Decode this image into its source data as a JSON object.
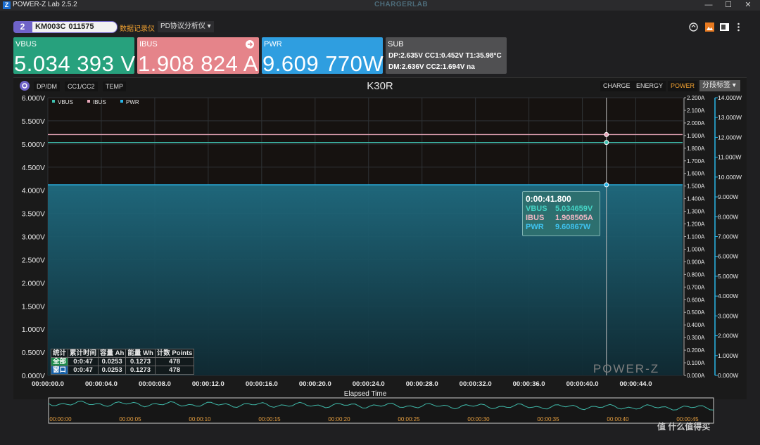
{
  "app": {
    "title": "POWER-Z Lab 2.5.2",
    "brand": "CHARGERLAB",
    "logo": "Z"
  },
  "window_controls": {
    "minimize": "—",
    "maximize": "☐",
    "close": "✕"
  },
  "device": {
    "index": "2",
    "model": "KM003C",
    "serial": "011575"
  },
  "modes": {
    "recorder": "数据记录仪",
    "pd_analyzer": "PD协议分析仪 ▾"
  },
  "cards": {
    "vbus": {
      "label": "VBUS",
      "value": "5.034 393 V",
      "color": "#27a17d"
    },
    "ibus": {
      "label": "IBUS",
      "value": "1.908 824 A",
      "color": "#e5848a"
    },
    "pwr": {
      "label": "PWR",
      "value": "9.609 770W",
      "color": "#2f9ee0"
    },
    "sub": {
      "label": "SUB",
      "row1": "DP:2.635V   CC1:0.452V  T1:35.98°C",
      "row2": "DM:2.636V   CC2:1.694V  na"
    }
  },
  "chart_toolbar": {
    "chips": [
      "DP/DM",
      "CC1/CC2",
      "TEMP"
    ],
    "tabs": [
      "CHARGE",
      "ENERGY",
      "POWER"
    ],
    "active_tab": "POWER",
    "select": "分段标签 ▾"
  },
  "chart_data": {
    "type": "line",
    "title": "K30R",
    "xlabel": "Elapsed Time",
    "x_ticks": [
      "00:00:00.0",
      "00:00:04.0",
      "00:00:08.0",
      "00:00:12.0",
      "00:00:16.0",
      "00:00:20.0",
      "00:00:24.0",
      "00:00:28.0",
      "00:00:32.0",
      "00:00:36.0",
      "00:00:40.0",
      "00:00:44.0"
    ],
    "xlim": [
      0,
      47.5
    ],
    "y_left": {
      "unit": "V",
      "range": [
        0,
        6
      ],
      "ticks": [
        "6.000V",
        "5.500V",
        "5.000V",
        "4.500V",
        "4.000V",
        "3.500V",
        "3.000V",
        "2.500V",
        "2.000V",
        "1.500V",
        "1.000V",
        "0.500V",
        "0.000V"
      ]
    },
    "y_mid": {
      "unit": "A",
      "range": [
        0,
        2.2
      ],
      "ticks": [
        "2.200A",
        "2.100A",
        "2.000A",
        "1.900A",
        "1.800A",
        "1.700A",
        "1.600A",
        "1.500A",
        "1.400A",
        "1.300A",
        "1.200A",
        "1.100A",
        "1.000A",
        "0.900A",
        "0.800A",
        "0.700A",
        "0.600A",
        "0.500A",
        "0.400A",
        "0.300A",
        "0.200A",
        "0.100A",
        "0.000A"
      ]
    },
    "y_right": {
      "unit": "W",
      "range": [
        0,
        14
      ],
      "ticks": [
        "14.000W",
        "13.000W",
        "12.000W",
        "11.000W",
        "10.000W",
        "9.000W",
        "8.000W",
        "7.000W",
        "6.000W",
        "5.000W",
        "4.000W",
        "3.000W",
        "2.000W",
        "1.000W",
        "0.000W"
      ]
    },
    "legend": [
      "VBUS",
      "IBUS",
      "PWR"
    ],
    "legend_placement": "top-left",
    "series": [
      {
        "name": "VBUS",
        "color": "#3fc1b0",
        "axis": "left",
        "x": [
          0,
          47.5
        ],
        "y": [
          5.034,
          5.034
        ]
      },
      {
        "name": "IBUS",
        "color": "#e8a6b8",
        "axis": "mid",
        "x": [
          0,
          47.5
        ],
        "y": [
          1.908,
          1.908
        ]
      },
      {
        "name": "PWR",
        "color": "#29b6e8",
        "axis": "right",
        "x": [
          0,
          47.5
        ],
        "y": [
          9.61,
          9.61
        ],
        "fill": true
      }
    ],
    "cursor_x": 41.8,
    "grid": true,
    "watermark": "POWER-Z"
  },
  "tooltip": {
    "time": "0:00:41.800",
    "rows": [
      {
        "k": "VBUS",
        "v": "5.034659V",
        "color": "#45d3c4"
      },
      {
        "k": "IBUS",
        "v": "1.908505A",
        "color": "#f0b8c4"
      },
      {
        "k": "PWR",
        "v": "9.60867W",
        "color": "#3fc3f0"
      }
    ]
  },
  "stats": {
    "headers": [
      "统计",
      "累计时间",
      "容量 Ah",
      "能量 Wh",
      "计数 Points"
    ],
    "rows": [
      [
        "全部",
        "0:0:47",
        "0.0253",
        "0.1273",
        "478"
      ],
      [
        "窗口",
        "0:0:47",
        "0.0253",
        "0.1273",
        "478"
      ]
    ]
  },
  "overview": {
    "ticks": [
      "00:00:00",
      "00:00:05",
      "00:00:10",
      "00:00:15",
      "00:00:20",
      "00:00:25",
      "00:00:30",
      "00:00:35",
      "00:00:40",
      "00:00:45"
    ],
    "tick_color": "#e8a040",
    "line_color": "#3fb8a8"
  },
  "corner_watermark": "值 什么值得买"
}
